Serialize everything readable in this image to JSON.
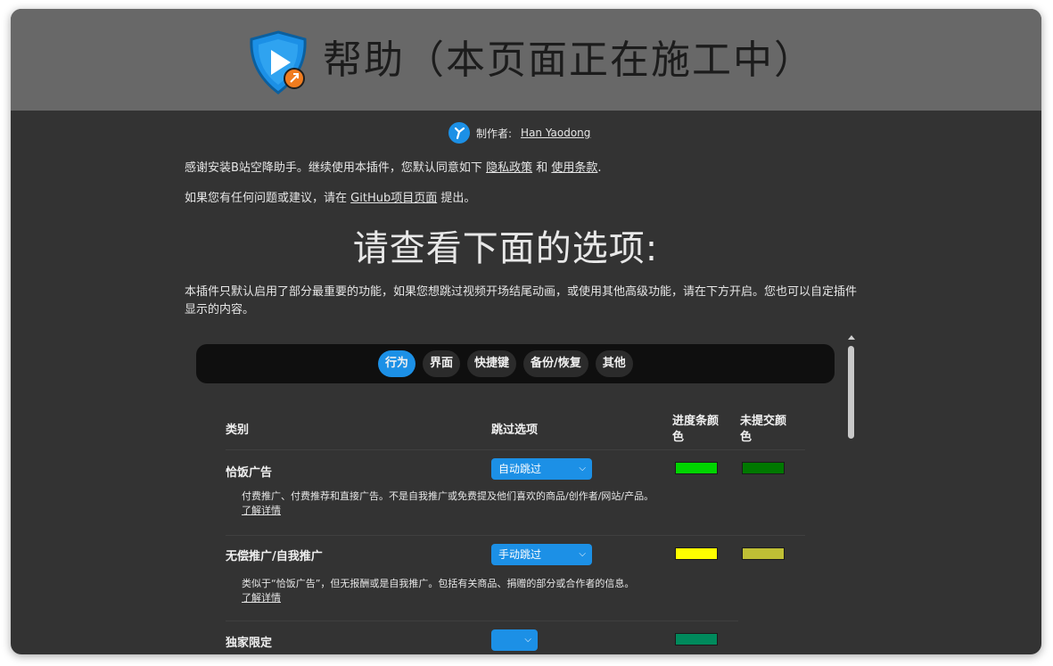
{
  "header": {
    "title": "帮助（本页面正在施工中）"
  },
  "author": {
    "label": "制作者:",
    "name": "Han Yaodong"
  },
  "notice": {
    "thanks_prefix": "感谢安装B站空降助手。继续使用本插件，您默认同意如下",
    "privacy_link": "隐私政策",
    "and": "和",
    "terms_link": "使用条款",
    "period": ".",
    "feedback_prefix": "如果您有任何问题或建议，请在",
    "github_link": "GitHub项目页面",
    "feedback_suffix": "提出。"
  },
  "heading": "请查看下面的选项:",
  "intro": "本插件只默认启用了部分最重要的功能，如果您想跳过视频开场结尾动画，或使用其他高级功能，请在下方开启。您也可以自定插件显示的内容。",
  "tabs": [
    "行为",
    "界面",
    "快捷键",
    "备份/恢复",
    "其他"
  ],
  "table": {
    "headers": {
      "category": "类别",
      "skip": "跳过选项",
      "progress_color": "进度条颜色",
      "unsubmitted_color": "未提交颜色"
    },
    "rows": [
      {
        "name": "恰饭广告",
        "skip": "自动跳过",
        "desc": "付费推广、付费推荐和直接广告。不是自我推广或免费提及他们喜欢的商品/创作者/网站/产品。",
        "more": "了解详情",
        "progress_color": "#00d400",
        "unsubmitted_color": "#007800"
      },
      {
        "name": "无偿推广/自我推广",
        "skip": "手动跳过",
        "desc": "类似于“恰饭广告”，但无报酬或是自我推广。包括有关商品、捐赠的部分或合作者的信息。",
        "more": "了解详情",
        "progress_color": "#ffff00",
        "unsubmitted_color": "#bfbf35"
      },
      {
        "name": "独家限定",
        "skip": "",
        "progress_color": "#008a5c"
      }
    ]
  },
  "colors": {
    "accent": "#1c90e6",
    "background": "#333333",
    "header": "#686868"
  }
}
